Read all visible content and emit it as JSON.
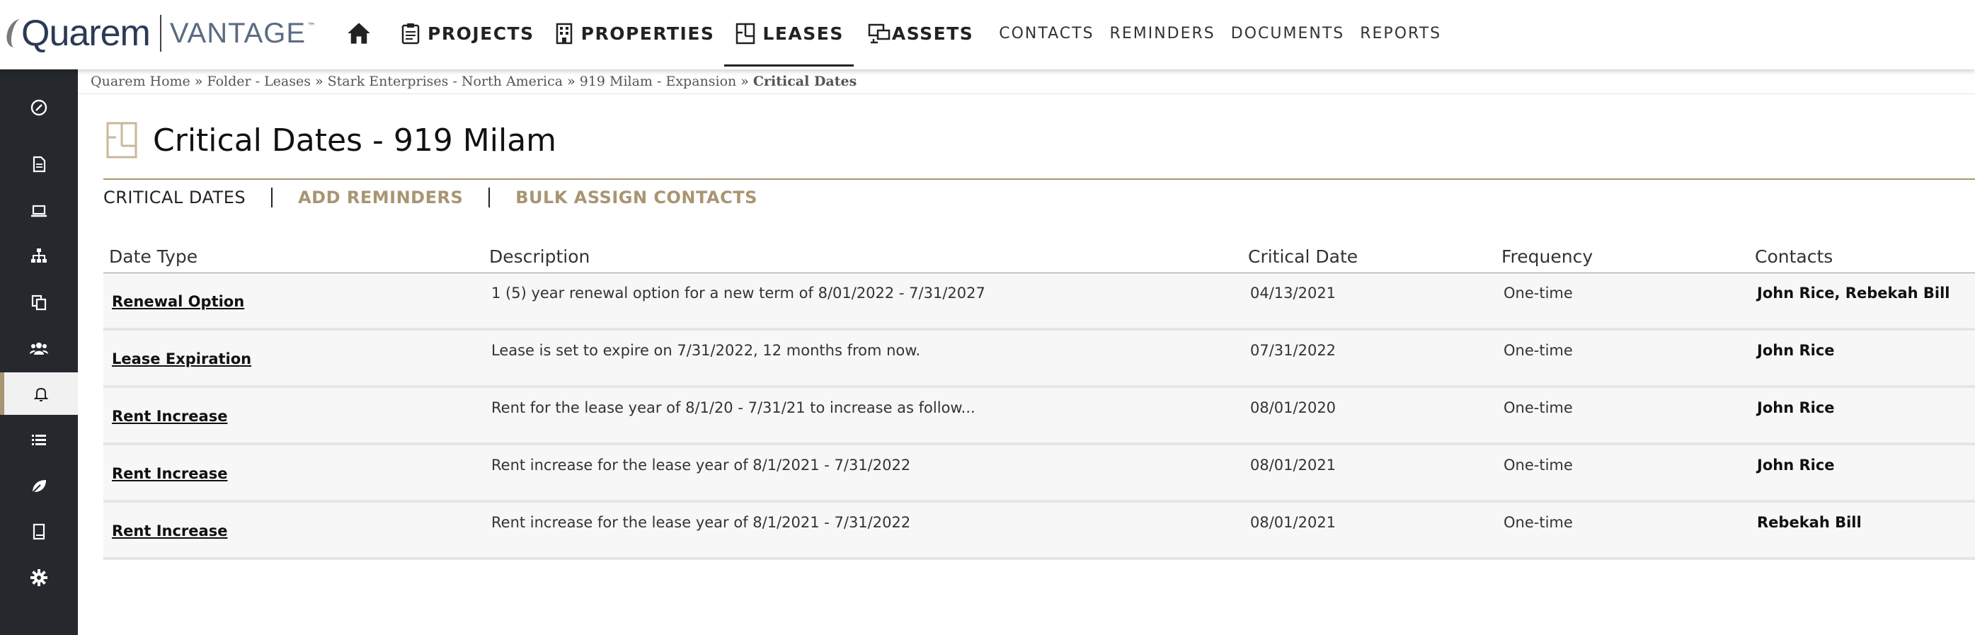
{
  "brand": {
    "name": "Quarem",
    "product": "VANTAGE",
    "tm": "™"
  },
  "nav": {
    "items": [
      {
        "label": "",
        "icon": "home-icon"
      },
      {
        "label": "PROJECTS",
        "icon": "clipboard-icon"
      },
      {
        "label": "PROPERTIES",
        "icon": "building-icon"
      },
      {
        "label": "LEASES",
        "icon": "floorplan-icon",
        "active": true
      },
      {
        "label": "ASSETS",
        "icon": "assets-icon"
      },
      {
        "label": "CONTACTS"
      },
      {
        "label": "REMINDERS"
      },
      {
        "label": "DOCUMENTS"
      },
      {
        "label": "REPORTS"
      }
    ]
  },
  "sidebar": {
    "icons": [
      "compass-icon",
      "document-icon",
      "laptop-icon",
      "org-chart-icon",
      "copy-icon",
      "users-icon",
      "bell-icon",
      "list-icon",
      "leaf-icon",
      "book-icon",
      "gear-icon"
    ],
    "active": "bell-icon"
  },
  "breadcrumb": {
    "items": [
      "Quarem Home",
      "Folder - Leases",
      "Stark Enterprises - North America",
      "919 Milam - Expansion"
    ],
    "separator": "»",
    "current": "Critical Dates"
  },
  "page": {
    "title": "Critical Dates - 919 Milam"
  },
  "tabs": {
    "current": "CRITICAL DATES",
    "add_reminders": "ADD REMINDERS",
    "bulk_assign": "BULK ASSIGN CONTACTS"
  },
  "table": {
    "headers": [
      "Date Type",
      "Description",
      "Critical Date",
      "Frequency",
      "Contacts"
    ],
    "rows": [
      {
        "type": "Renewal Option",
        "description": "1 (5) year renewal option for a new term of 8/01/2022 - 7/31/2027",
        "date": "04/13/2021",
        "frequency": "One-time",
        "contacts": "John Rice, Rebekah Bill"
      },
      {
        "type": "Lease Expiration",
        "description": "Lease is set to expire on 7/31/2022, 12 months from now.",
        "date": "07/31/2022",
        "frequency": "One-time",
        "contacts": "John Rice"
      },
      {
        "type": "Rent Increase",
        "description": "Rent for the lease year of 8/1/20 - 7/31/21 to increase as follow...",
        "date": "08/01/2020",
        "frequency": "One-time",
        "contacts": "John Rice"
      },
      {
        "type": "Rent Increase",
        "description": "Rent increase for the lease year of 8/1/2021 - 7/31/2022",
        "date": "08/01/2021",
        "frequency": "One-time",
        "contacts": "John Rice"
      },
      {
        "type": "Rent Increase",
        "description": "Rent increase for the lease year of 8/1/2021 - 7/31/2022",
        "date": "08/01/2021",
        "frequency": "One-time",
        "contacts": "Rebekah Bill"
      }
    ]
  },
  "colors": {
    "accent": "#a89572",
    "sidebar": "#25282d",
    "brand": "#2b3a55"
  }
}
